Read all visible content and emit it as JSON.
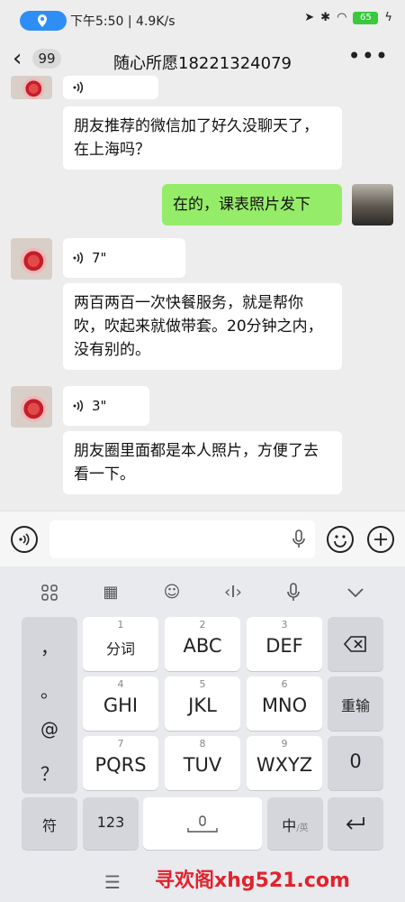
{
  "status_bar": {
    "time": "下午5:50 | 4.9K/s",
    "battery": "65"
  },
  "header": {
    "unread_count": "99",
    "title": "随心所愿18221324079"
  },
  "messages": {
    "m1_text": "朋友推荐的微信加了好久没聊天了，在上海吗？",
    "m2_text": "在的，课表照片发下",
    "voice1_duration": "7\"",
    "m3_text": "两百两百一次快餐服务，就是帮你吹，吹起来就做带套。20分钟之内，没有别的。",
    "voice2_duration": "3\"",
    "m4_text": "朋友圈里面都是本人照片，方便了去看一下。"
  },
  "keyboard": {
    "keys": {
      "k1_num": "1",
      "k1": "分词",
      "k2_num": "2",
      "k2": "ABC",
      "k3_num": "3",
      "k3": "DEF",
      "k4_num": "4",
      "k4": "GHI",
      "k5_num": "5",
      "k5": "JKL",
      "k6_num": "6",
      "k6": "MNO",
      "k7_num": "7",
      "k7": "PQRS",
      "k8_num": "8",
      "k8": "TUV",
      "k9_num": "9",
      "k9": "WXYZ",
      "reenter": "重输",
      "zero": "0",
      "symbol": "符",
      "numeric": "123",
      "lang_zh": "中",
      "lang_en": "/英"
    },
    "punct": {
      "p1": "，",
      "p2": "。",
      "p3": "@",
      "p4": "？"
    }
  },
  "watermark": "寻欢阁xhg521.com",
  "icons": [
    "location-icon",
    "send-icon",
    "bluetooth-icon",
    "wifi-icon",
    "battery-icon",
    "back-icon",
    "more-icon",
    "voice-wave-icon",
    "mic-icon",
    "emoji-icon",
    "plus-icon",
    "backspace-icon",
    "enter-icon",
    "collapse-icon"
  ]
}
